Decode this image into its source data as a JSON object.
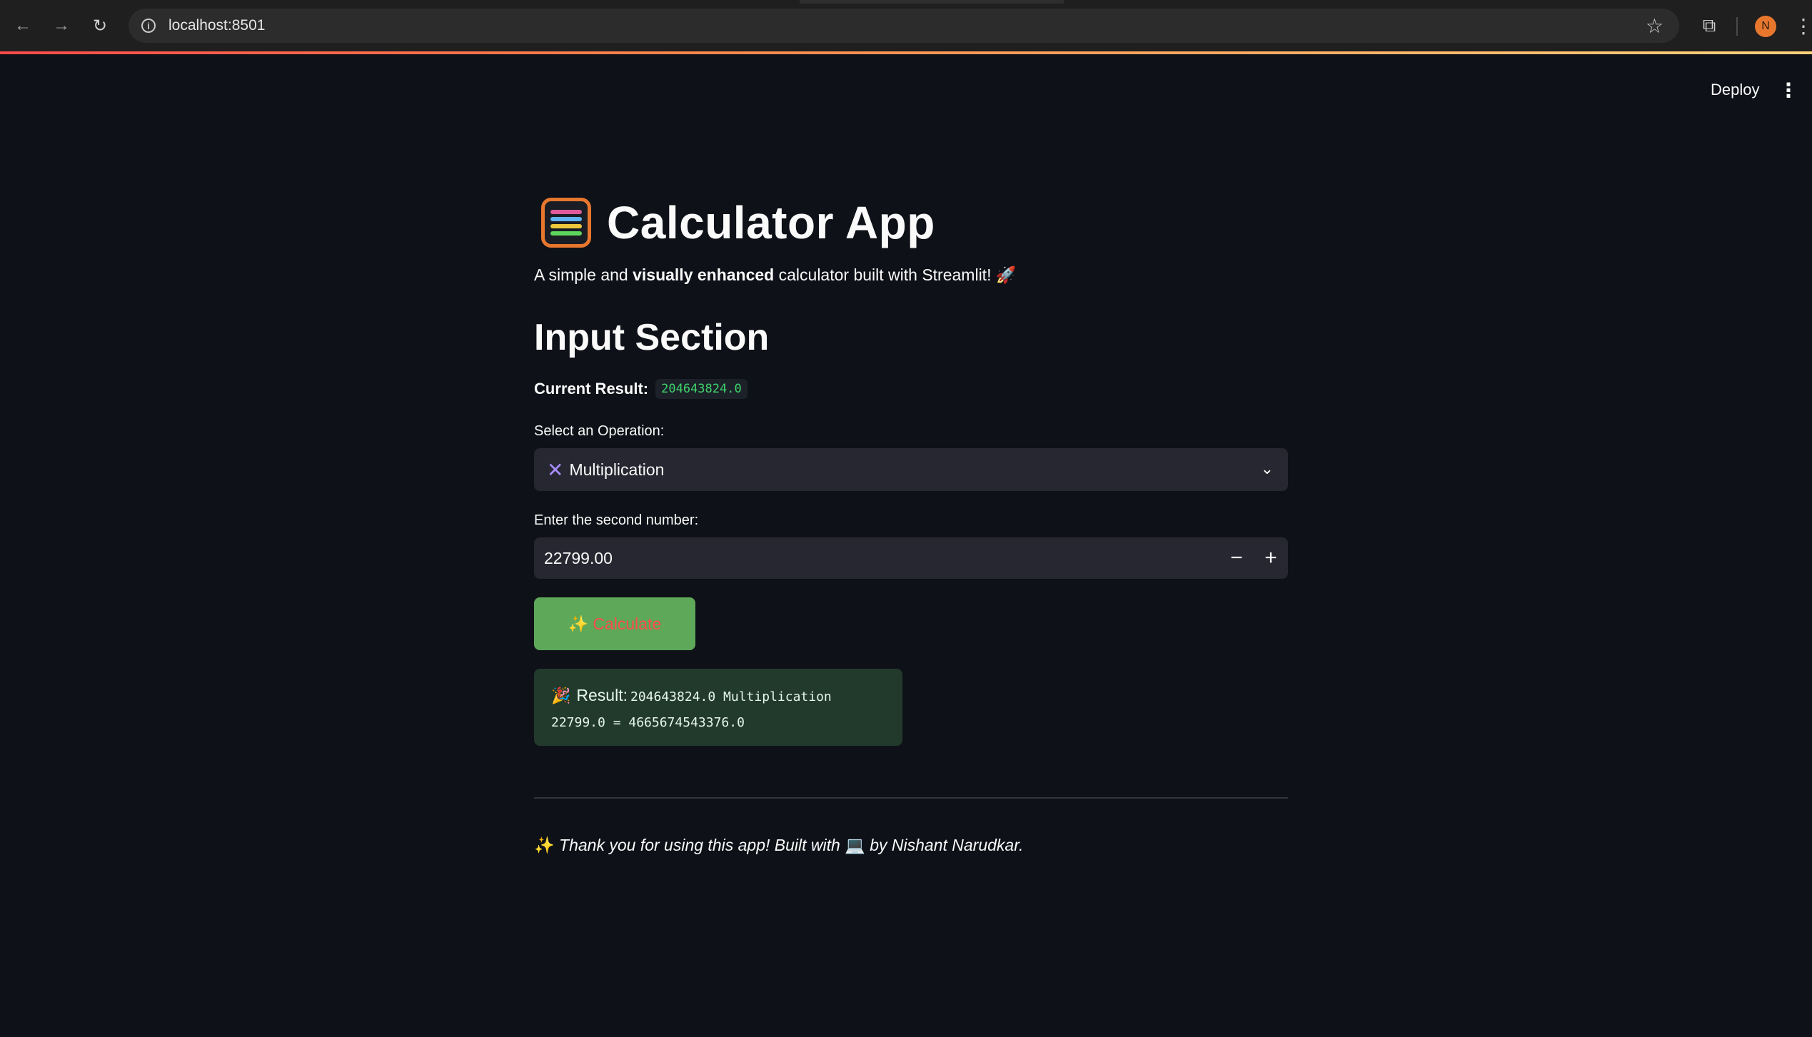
{
  "browser": {
    "url": "localhost:8501",
    "profile_initial": "N",
    "icons": {
      "back": "←",
      "forward": "→",
      "reload": "↻",
      "info": "i",
      "star": "☆",
      "extensions": "⧉",
      "menu": "⋮"
    }
  },
  "header": {
    "deploy_label": "Deploy",
    "menu_glyph": "⋮"
  },
  "app": {
    "title": "Calculator App",
    "subtitle_pre": "A simple and ",
    "subtitle_bold": "visually enhanced",
    "subtitle_post": " calculator built with Streamlit! 🚀",
    "section_heading": "Input Section",
    "current_result_label": "Current Result:",
    "current_result_value": "204643824.0",
    "operation_label": "Select an Operation:",
    "operation_icon": "✕",
    "operation_value": "Multiplication",
    "operation_chevron": "⌄",
    "second_number_label": "Enter the second number:",
    "second_number_value": "22799.00",
    "minus_glyph": "−",
    "plus_glyph": "+",
    "calculate_sparkle": "✨",
    "calculate_label": "Calculate",
    "result_icon": "🎉",
    "result_label": "Result:",
    "result_line1": "204643824.0 Multiplication",
    "result_line2": "22799.0 = 4665674543376.0",
    "footer_sparkle": "✨",
    "footer_pre": " Thank you for using this app! Built with ",
    "footer_laptop": "💻",
    "footer_post": " by Nishant Narudkar."
  },
  "colors": {
    "background": "#0e1117",
    "input_bg": "#262730",
    "button_bg": "#5ea859",
    "button_text": "#ff4b4b",
    "result_bg": "#223a2b",
    "code_green": "#3dd56d",
    "avatar": "#e8772e"
  }
}
